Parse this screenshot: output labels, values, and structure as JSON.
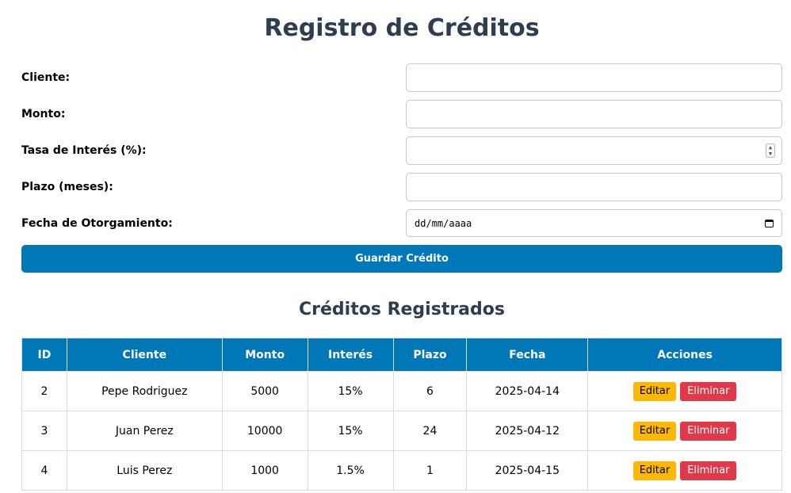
{
  "page": {
    "title": "Registro de Créditos"
  },
  "form": {
    "fields": [
      {
        "label": "Cliente:",
        "value": "",
        "type": "text"
      },
      {
        "label": "Monto:",
        "value": "",
        "type": "text"
      },
      {
        "label": "Tasa de Interés (%):",
        "value": "",
        "type": "number"
      },
      {
        "label": "Plazo (meses):",
        "value": "",
        "type": "text"
      },
      {
        "label": "Fecha de Otorgamiento:",
        "value": "",
        "type": "date",
        "placeholder": "dd/mm/aaaa"
      }
    ],
    "submit_label": "Guardar Crédito"
  },
  "list": {
    "title": "Créditos Registrados",
    "columns": [
      "ID",
      "Cliente",
      "Monto",
      "Interés",
      "Plazo",
      "Fecha",
      "Acciones"
    ],
    "rows": [
      {
        "id": "2",
        "cliente": "Pepe Rodriguez",
        "monto": "5000",
        "interes": "15%",
        "plazo": "6",
        "fecha": "2025-04-14"
      },
      {
        "id": "3",
        "cliente": "Juan Perez",
        "monto": "10000",
        "interes": "15%",
        "plazo": "24",
        "fecha": "2025-04-12"
      },
      {
        "id": "4",
        "cliente": "Luis Perez",
        "monto": "1000",
        "interes": "1.5%",
        "plazo": "1",
        "fecha": "2025-04-15"
      }
    ],
    "edit_label": "Editar",
    "delete_label": "Eliminar"
  },
  "colors": {
    "primary": "#0077b6",
    "heading": "#2c3e50",
    "edit": "#ffb800",
    "delete": "#e03a4a"
  }
}
